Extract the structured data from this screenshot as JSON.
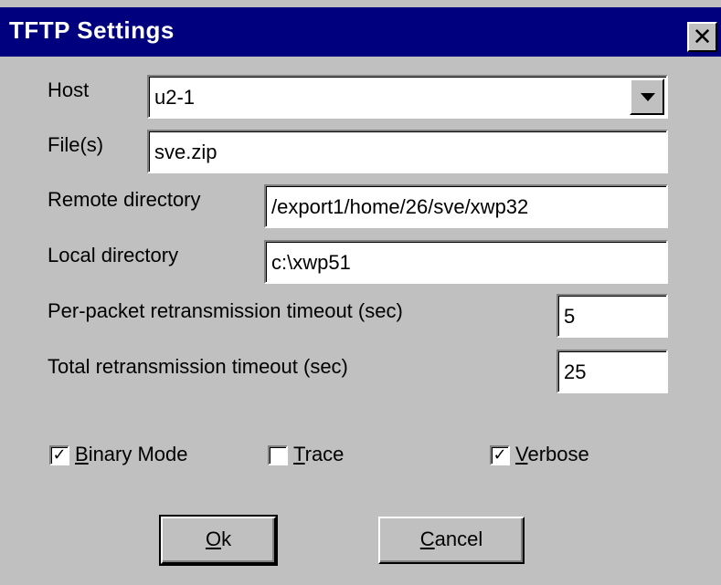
{
  "dialog": {
    "title": "TFTP Settings",
    "close_glyph": "✕"
  },
  "fields": {
    "host": {
      "label": "Host",
      "value": "u2-1"
    },
    "files": {
      "label": "File(s)",
      "value": "sve.zip"
    },
    "remote_dir": {
      "label": "Remote directory",
      "value": "/export1/home/26/sve/xwp32"
    },
    "local_dir": {
      "label": "Local directory",
      "value": "c:\\xwp51"
    },
    "per_packet": {
      "label": "Per-packet retransmission timeout (sec)",
      "value": "5"
    },
    "total": {
      "label": "Total retransmission timeout (sec)",
      "value": "25"
    }
  },
  "checkboxes": {
    "binary": {
      "accel": "B",
      "rest": "inary Mode",
      "checked": true
    },
    "trace": {
      "accel": "T",
      "rest": "race",
      "checked": false
    },
    "verbose": {
      "accel": "V",
      "rest": "erbose",
      "checked": true
    }
  },
  "buttons": {
    "ok": {
      "accel": "O",
      "rest": "k"
    },
    "cancel": {
      "accel": "C",
      "rest": "ancel"
    }
  },
  "colors": {
    "titlebar": "#00007f",
    "face": "#c0c0c0"
  }
}
